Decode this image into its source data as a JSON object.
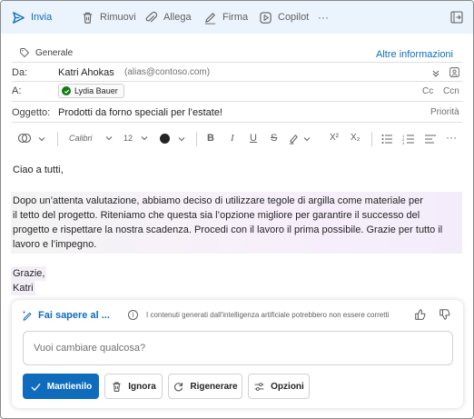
{
  "toolbar": {
    "send_label": "Invia",
    "discard_label": "Rimuovi",
    "attach_label": "Allega",
    "signature_label": "Firma",
    "copilot_label": "Copilot",
    "more_label": "···"
  },
  "header": {
    "sensitivity_label": "Generale",
    "more_info_label": "Altre informazioni",
    "from_label": "Da:",
    "from_name": "Katri Ahokas",
    "from_alias": "(alias@contoso.com)",
    "to_label": "A:",
    "to_recipient": "Lydia Bauer",
    "cc_label": "Cc",
    "bcc_label": "Ccn",
    "subject_label": "Oggetto:",
    "subject_value": "Prodotti da forno speciali per l’estate!",
    "priority_label": "Priorità"
  },
  "format": {
    "font_name": "Calibri",
    "font_size": "12",
    "bold": "B",
    "italic": "I",
    "underline": "U",
    "strike": "S",
    "superscript": "X²",
    "subscript": "X₂"
  },
  "body": {
    "greeting": "Ciao a tutti,",
    "paragraph_line1": "Dopo un’attenta valutazione, abbiamo deciso di utilizzare tegole di argilla come materiale per",
    "paragraph_line2": "il tetto del progetto. Riteniamo che questa sia l’opzione migliore per garantire il successo del",
    "paragraph_line3": "progetto e rispettare la nostra scadenza. Procedi con il lavoro il prima possibile. Grazie per tutto il",
    "paragraph_line4": "lavoro e l’impegno.",
    "closing": "Grazie,",
    "signature": "Katri"
  },
  "copilot": {
    "title": "Fai sapere al ...",
    "disclaimer": "I contenuti generati dall'intelligenza artificiale potrebbero non essere corretti",
    "prompt_placeholder": "Vuoi cambiare qualcosa?",
    "keep_label": "Mantienilo",
    "ignore_label": "Ignora",
    "regenerate_label": "Rigenerare",
    "options_label": "Opzioni"
  },
  "colors": {
    "accent": "#0f6cbd",
    "toolbar_bg": "#ebf3fc",
    "status_ok": "#107c10"
  }
}
